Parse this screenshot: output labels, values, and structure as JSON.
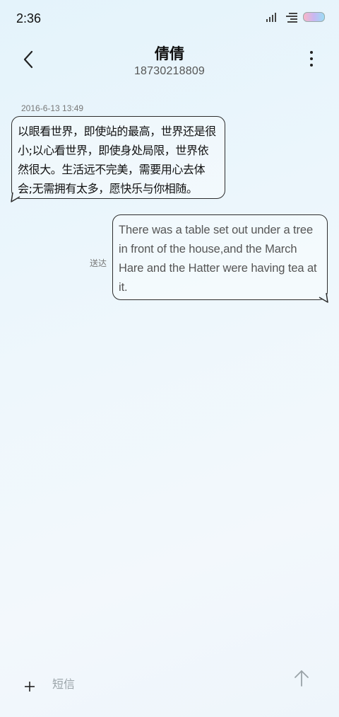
{
  "status_bar": {
    "time": "2:36",
    "icons": [
      "signal-icon",
      "network-icon",
      "battery-icon"
    ]
  },
  "header": {
    "contact_name": "倩倩",
    "contact_number": "18730218809",
    "back_icon": "chevron-left-icon",
    "more_icon": "more-vertical-icon"
  },
  "conversation": {
    "timestamp": "2016-6-13 13:49",
    "messages": [
      {
        "direction": "incoming",
        "text": "以眼看世界，即使站的最高，世界还是很小;以心看世界，即使身处局限，世界依然很大。生活远不完美，需要用心去体会;无需拥有太多，愿快乐与你相随。"
      },
      {
        "direction": "outgoing",
        "status": "送达",
        "text": "There was a table set out under a tree in front of the house,and the March Hare and the Hatter were having tea at it."
      }
    ]
  },
  "composer": {
    "placeholder": "短信",
    "value": "",
    "add_icon": "plus-icon",
    "send_icon": "arrow-up-icon"
  },
  "colors": {
    "bubble_border": "#2d2d2d",
    "timestamp_text": "#777777",
    "outgoing_text": "#555555"
  }
}
